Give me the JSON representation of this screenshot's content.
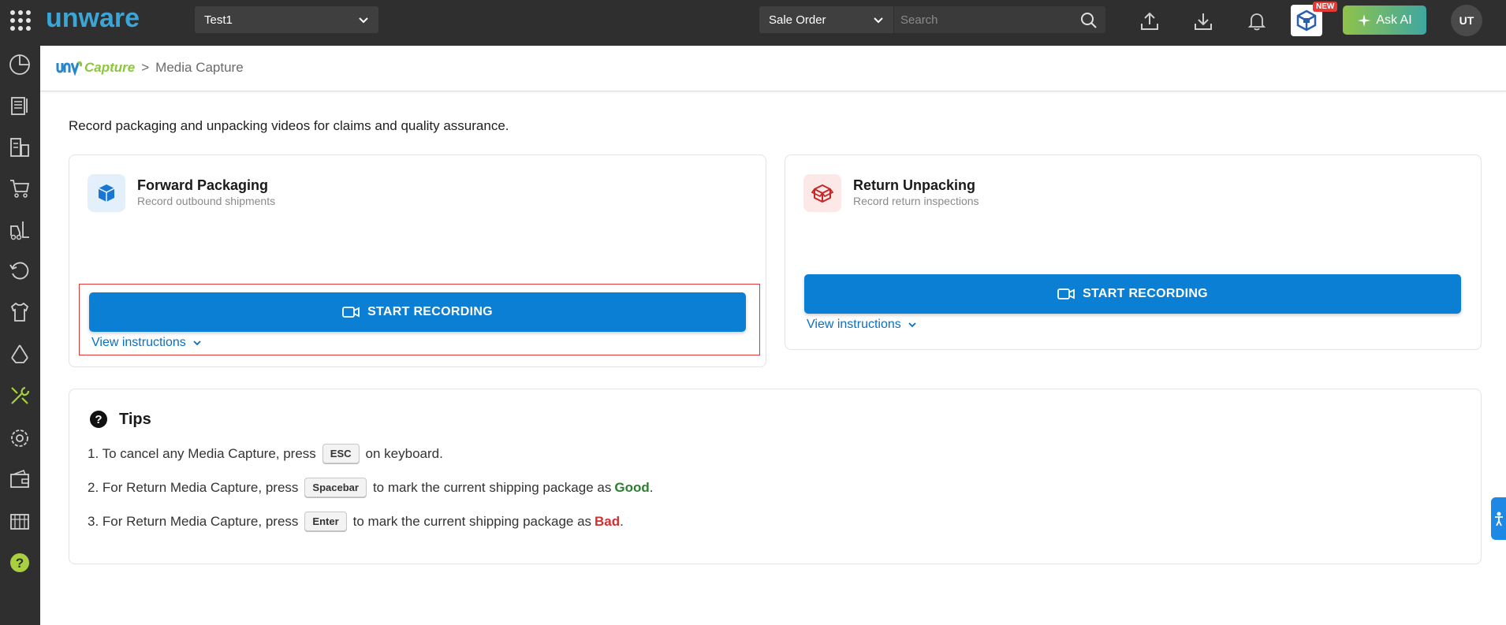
{
  "topbar": {
    "logo_text": "unware",
    "facility": "Test1",
    "search_type": "Sale Order",
    "search_placeholder": "Search",
    "new_badge": "NEW",
    "ask_ai_label": "Ask AI",
    "avatar_initials": "UT"
  },
  "sidebar": {
    "items": [
      {
        "icon": "dashboard-icon"
      },
      {
        "icon": "orders-icon"
      },
      {
        "icon": "warehouse-icon"
      },
      {
        "icon": "cart-icon"
      },
      {
        "icon": "forklift-icon"
      },
      {
        "icon": "returns-icon"
      },
      {
        "icon": "apparel-icon"
      },
      {
        "icon": "recycle-icon"
      },
      {
        "icon": "tools-icon"
      },
      {
        "icon": "settings-icon"
      },
      {
        "icon": "wallet-icon"
      },
      {
        "icon": "inventory-icon"
      },
      {
        "icon": "help-icon"
      }
    ]
  },
  "breadcrumb": {
    "app": "Capture",
    "separator": ">",
    "page": "Media Capture"
  },
  "intro": "Record packaging and unpacking videos for claims and quality assurance.",
  "cards": {
    "forward": {
      "title": "Forward Packaging",
      "subtitle": "Record outbound shipments",
      "button": "START RECORDING",
      "instructions": "View instructions"
    },
    "return": {
      "title": "Return Unpacking",
      "subtitle": "Record return inspections",
      "button": "START RECORDING",
      "instructions": "View instructions"
    }
  },
  "tips": {
    "title": "Tips",
    "tip1": {
      "prefix": "1. To cancel any Media Capture, press",
      "key": "ESC",
      "suffix": "on keyboard."
    },
    "tip2": {
      "prefix": "2. For Return Media Capture, press",
      "key": "Spacebar",
      "suffix": "to mark the current shipping package as",
      "status": "Good",
      "end": "."
    },
    "tip3": {
      "prefix": "3. For Return Media Capture, press",
      "key": "Enter",
      "suffix": "to mark the current shipping package as",
      "status": "Bad",
      "end": "."
    }
  },
  "colors": {
    "topbar": "#2f2f2f",
    "primary_button": "#0a7fd4",
    "link": "#0a6fc2",
    "good": "#2e7d32",
    "bad": "#d32f2f",
    "accent_green": "#8cc63f"
  }
}
